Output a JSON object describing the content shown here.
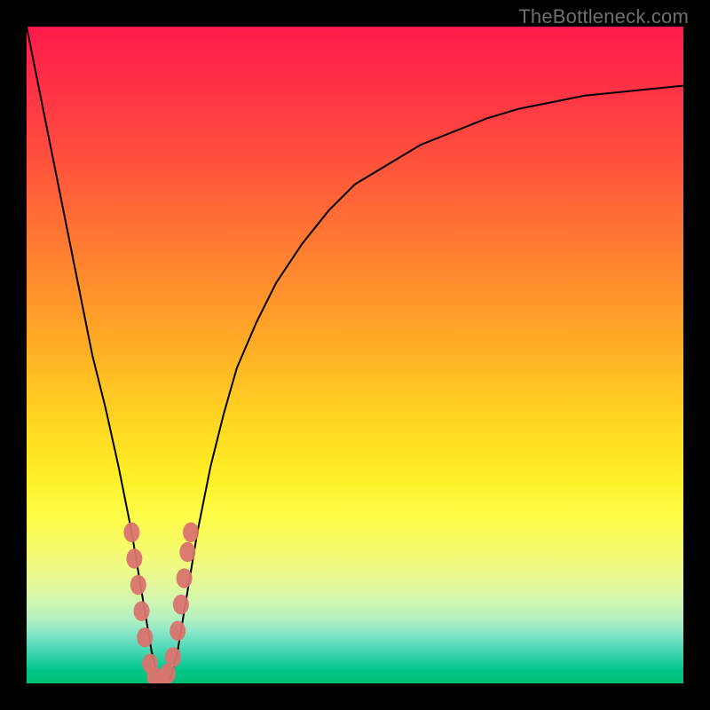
{
  "watermark": "TheBottleneck.com",
  "colors": {
    "frame": "#000000",
    "curve": "#000000",
    "dots": "#d9746f",
    "gradient_top": "#ff1a4b",
    "gradient_bottom": "#00bf78"
  },
  "chart_data": {
    "type": "line",
    "title": "",
    "xlabel": "",
    "ylabel": "",
    "xlim": [
      0,
      100
    ],
    "ylim": [
      0,
      100
    ],
    "grid": false,
    "legend": false,
    "x": [
      0,
      2,
      4,
      6,
      8,
      10,
      12,
      14,
      15,
      16,
      17,
      18,
      19,
      20,
      21,
      22,
      23,
      24,
      25,
      26,
      28,
      30,
      32,
      35,
      38,
      42,
      46,
      50,
      55,
      60,
      65,
      70,
      75,
      80,
      85,
      90,
      95,
      100
    ],
    "y": [
      100,
      90,
      80,
      70,
      60,
      50,
      42,
      33,
      28,
      23,
      17,
      11,
      5,
      1,
      0,
      1,
      5,
      11,
      17,
      23,
      33,
      41,
      48,
      55,
      61,
      67,
      72,
      76,
      79,
      82,
      84,
      86,
      87.5,
      88.5,
      89.5,
      90,
      90.5,
      91
    ],
    "series": [
      {
        "name": "bottleneck-curve",
        "note": "single V-shaped curve; minimum at x≈20, rises asymptotically to ~91 on the right"
      }
    ],
    "markers": {
      "name": "highlighted-points",
      "points": [
        {
          "x": 16.0,
          "y": 23
        },
        {
          "x": 16.4,
          "y": 19
        },
        {
          "x": 17.0,
          "y": 15
        },
        {
          "x": 17.5,
          "y": 11
        },
        {
          "x": 18.0,
          "y": 7
        },
        {
          "x": 18.8,
          "y": 3
        },
        {
          "x": 19.5,
          "y": 1
        },
        {
          "x": 20.5,
          "y": 0.5
        },
        {
          "x": 21.5,
          "y": 1.5
        },
        {
          "x": 22.3,
          "y": 4
        },
        {
          "x": 23.0,
          "y": 8
        },
        {
          "x": 23.5,
          "y": 12
        },
        {
          "x": 24.0,
          "y": 16
        },
        {
          "x": 24.5,
          "y": 20
        },
        {
          "x": 25.0,
          "y": 23
        }
      ],
      "radius_px": 9
    }
  }
}
